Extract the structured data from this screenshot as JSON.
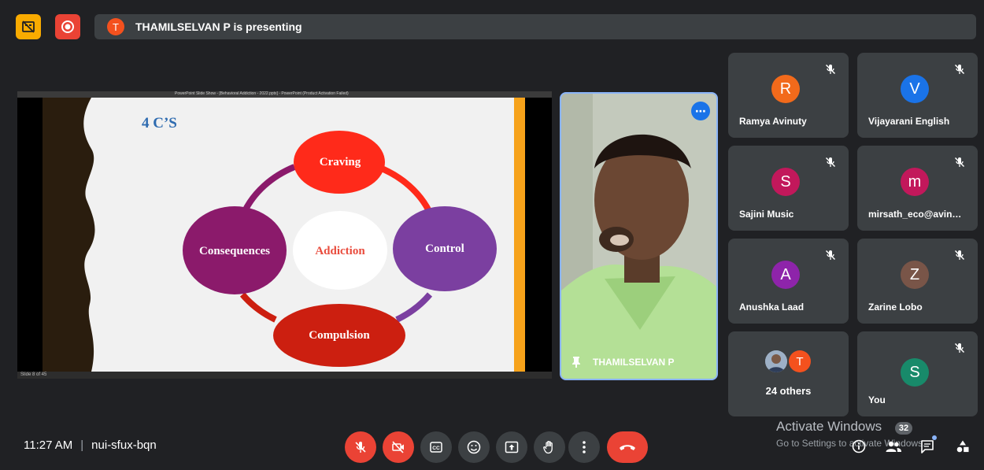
{
  "top_bar": {
    "presenter_initial": "T",
    "presenting_text": "THAMILSELVAN P is presenting"
  },
  "shared_screen": {
    "window_title": "PowerPoint Slide Show - [Behavioral Addiction - 2022.pptx] - PowerPoint (Product Activation Failed)",
    "slide_status": "Slide 8 of 45",
    "slide": {
      "title": "4 C’S",
      "center": "Addiction",
      "nodes": {
        "top": "Craving",
        "right": "Control",
        "bottom": "Compulsion",
        "left": "Consequences"
      }
    }
  },
  "presenter_tile": {
    "name": "THAMILSELVAN P"
  },
  "participants": [
    {
      "initial": "R",
      "name": "Ramya Avinuty",
      "color": "#f26a1b",
      "muted": true
    },
    {
      "initial": "V",
      "name": "Vijayarani English",
      "color": "#1a73e8",
      "muted": true
    },
    {
      "initial": "S",
      "name": "Sajini Music",
      "color": "#c2185b",
      "muted": true
    },
    {
      "initial": "m",
      "name": "mirsath_eco@avin…",
      "color": "#c2185b",
      "muted": true
    },
    {
      "initial": "A",
      "name": "Anushka Laad",
      "color": "#8e24aa",
      "muted": true
    },
    {
      "initial": "Z",
      "name": "Zarine Lobo",
      "color": "#795548",
      "muted": true
    }
  ],
  "others_tile": {
    "label": "24 others",
    "initial": "T"
  },
  "you_tile": {
    "initial": "S",
    "name": "You",
    "color": "#188a6a"
  },
  "bottom_bar": {
    "time": "11:27 AM",
    "separator": "|",
    "meeting_code": "nui-sfux-bqn",
    "activate_title": "Activate Windows",
    "activate_sub": "Go to Settings to activate Windows.",
    "people_count": "32"
  },
  "colors": {
    "background": "#202124",
    "tile": "#3c4043",
    "danger": "#ea4335",
    "accent": "#8ab4f8",
    "craving": "#ff2a1a",
    "control": "#7b3fa0",
    "compulsion": "#cc1f10",
    "consequences": "#8b1a6b"
  },
  "icons": [
    "no-captions-icon",
    "record-icon",
    "mic-off-icon",
    "camera-off-icon",
    "captions-icon",
    "emoji-icon",
    "present-icon",
    "hand-icon",
    "more-vert-icon",
    "end-call-icon",
    "info-icon",
    "people-icon",
    "chat-icon",
    "activities-icon"
  ]
}
